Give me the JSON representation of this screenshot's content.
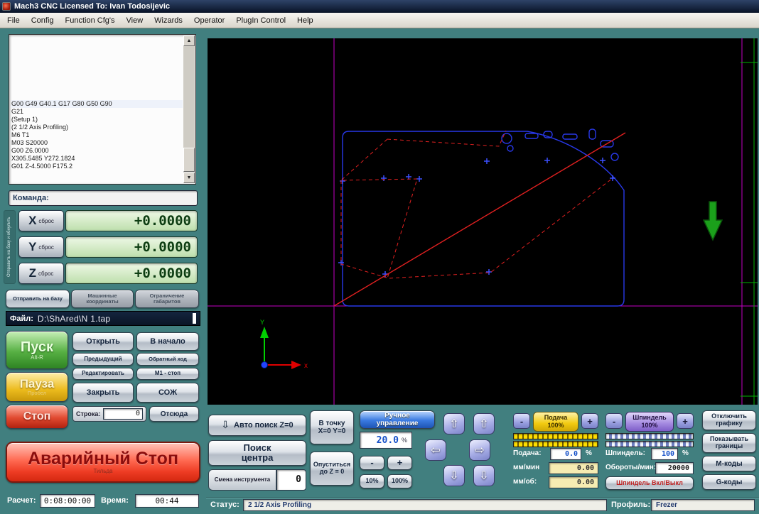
{
  "window": {
    "title": "Mach3 CNC  Licensed To: Ivan Todosijevic"
  },
  "menu": {
    "items": [
      "File",
      "Config",
      "Function Cfg's",
      "View",
      "Wizards",
      "Operator",
      "PlugIn Control",
      "Help"
    ]
  },
  "icons": {
    "scroll_up": "▲",
    "scroll_down": "▼",
    "jog_up": "⇧",
    "jog_down": "⇩",
    "jog_left": "⇦",
    "jog_right": "⇨"
  },
  "gcode": {
    "lines": [
      "G00 G49 G40.1 G17 G80 G50 G90",
      "G21",
      "(Setup 1)",
      "(2 1/2 Axis Profiling)",
      "M6 T1",
      "M03 S20000",
      "G00 Z6.0000",
      "X305.5485 Y272.1824",
      "G01  Z-4.5000  F175.2"
    ]
  },
  "command": {
    "label": "Команда:"
  },
  "dro": {
    "vertical_label": "Отправить на базу и обнулить",
    "reset_label": "сброс",
    "x_letter": "X",
    "y_letter": "Y",
    "z_letter": "Z",
    "x_value": "+0.0000",
    "y_value": "+0.0000",
    "z_value": "+0.0000",
    "ref_all": "Отправить на базу",
    "machine_coords": "Машинные координаты",
    "soft_limits": "Ограничение габаритов"
  },
  "file": {
    "label": "Файл:",
    "path": "D:\\ShAred\\N 1.tap"
  },
  "run": {
    "start": "Пуск",
    "start_key": "Alt-R",
    "open": "Открыть",
    "rewind": "В начало",
    "prev": "Предыдущий",
    "reverse": "Обратный ход",
    "edit": "Редактировать",
    "m1_stop": "M1 - стоп",
    "pause": "Пауза",
    "pause_key": "Пробел",
    "close": "Закрыть",
    "coolant": "СОЖ",
    "stop": "Стоп",
    "line_label": "Строка:",
    "line_value": "0",
    "from_here": "Отсюда",
    "estop": "Аварийный Стоп",
    "estop_key": "Тильда"
  },
  "timers": {
    "calc_label": "Расчет:",
    "calc_value": "0:08:00:00",
    "time_label": "Время:",
    "time_value": "00:44"
  },
  "jog": {
    "auto_z": "Авто поиск Z=0",
    "goto_line1": "В точку",
    "goto_line2": "X=0 Y=0",
    "mode": "Ручное управление",
    "step_value": "20.0",
    "step_unit": "%",
    "center_line1": "Поиск",
    "center_line2": "центра",
    "tool_change": "Смена инструмента",
    "tool_number": "0",
    "goz_line1": "Опуститься",
    "goz_line2": "до Z = 0",
    "minus": "-",
    "plus": "+",
    "pct10": "10%",
    "pct100": "100%"
  },
  "feed": {
    "dec": "-",
    "inc": "+",
    "title1": "Подача",
    "title2": "100%",
    "label": "Подача:",
    "value": "0.0",
    "unit": "%",
    "mmmin_label": "мм/мин",
    "mmmin_value": "0.00",
    "mmrev_label": "мм/об:",
    "mmrev_value": "0.00"
  },
  "spindle": {
    "dec": "-",
    "inc": "+",
    "title1": "Шпиндель",
    "title2": "100%",
    "label": "Шпиндель:",
    "value": "100",
    "unit": "%",
    "rpm_label": "Обороты/мин:",
    "rpm_value": "20000",
    "toggle": "Шпиндель Вкл/Выкл"
  },
  "view": {
    "toggle_graphics": "Отключить графику",
    "show_bounds": "Показывать границы",
    "m_codes": "М-коды",
    "g_codes": "G-коды"
  },
  "status": {
    "label": "Статус:",
    "value": "2 1/2 Axis Profiling",
    "profile_label": "Профиль:",
    "profile_value": "Frezer"
  }
}
